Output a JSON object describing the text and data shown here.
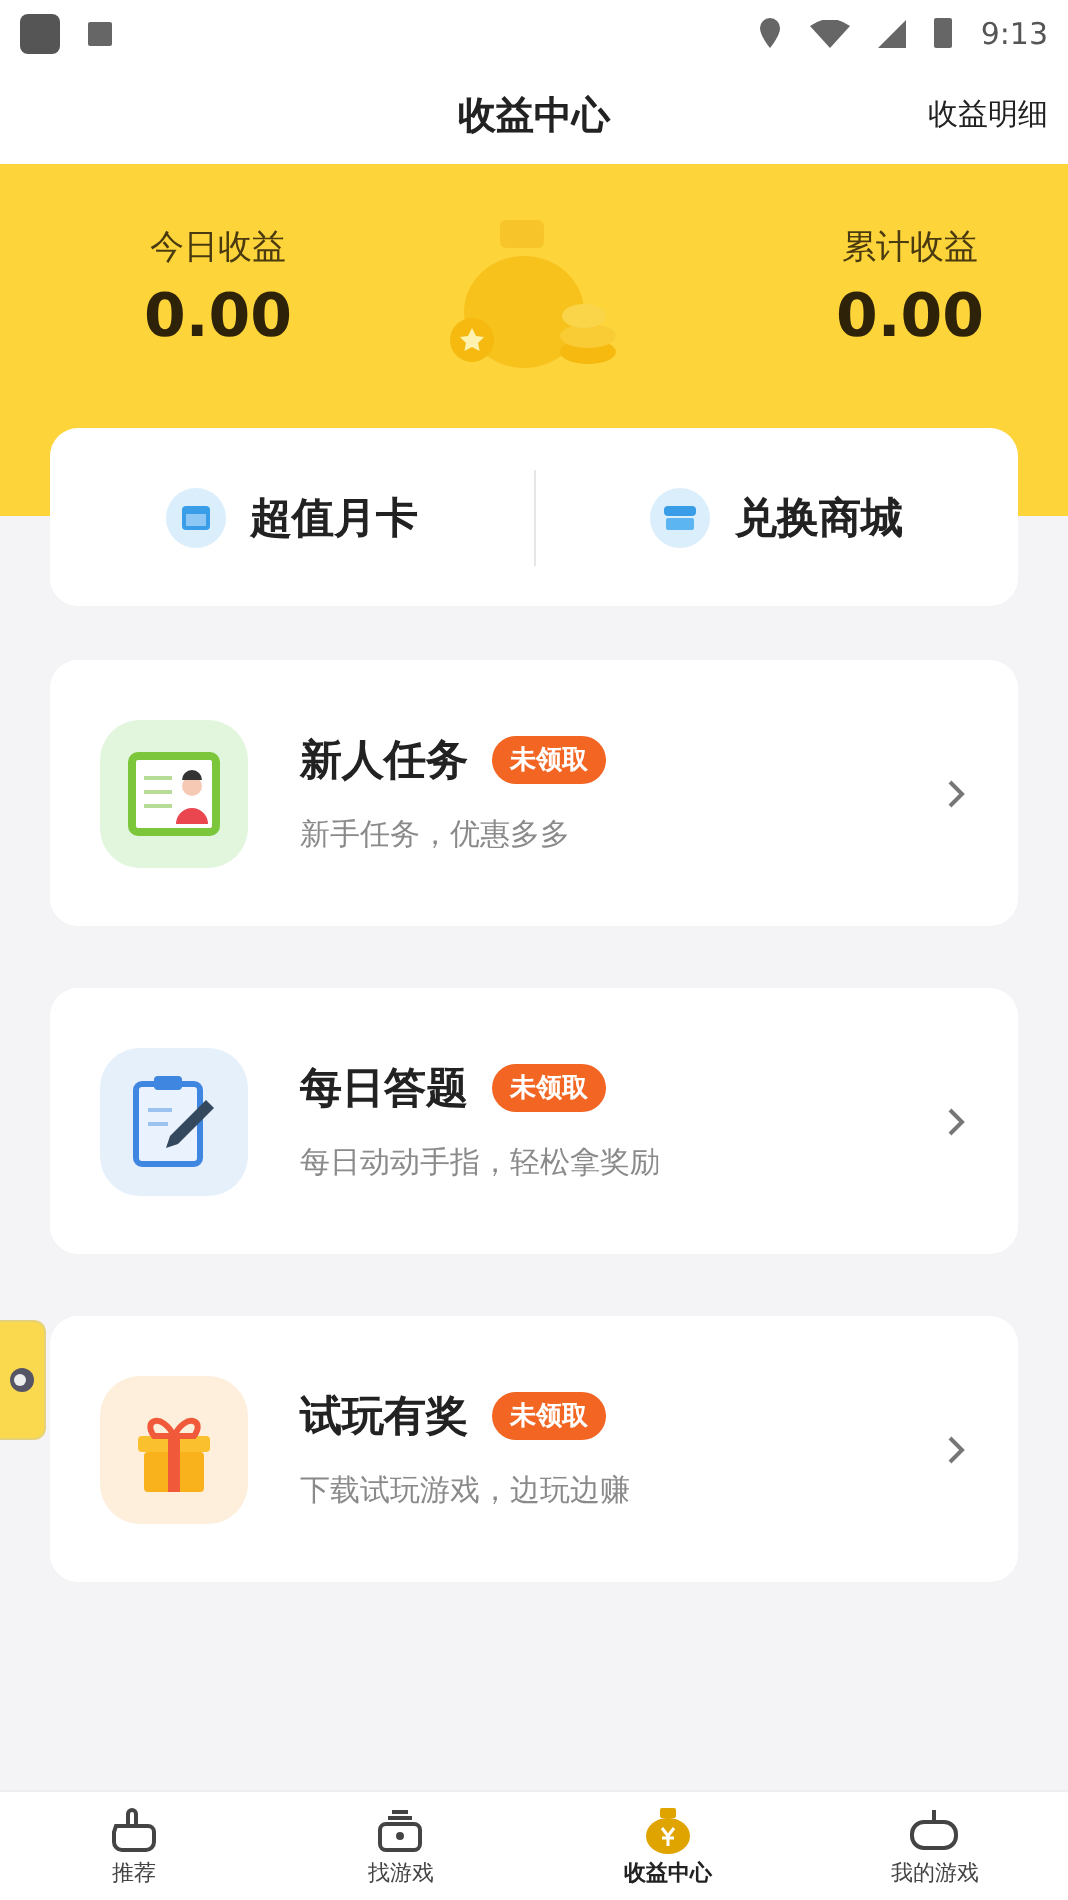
{
  "status_bar": {
    "time": "9:13"
  },
  "header": {
    "title": "收益中心",
    "action": "收益明细"
  },
  "earnings": [
    {
      "label": "今日收益",
      "value": "0.00"
    },
    {
      "label": "累计收益",
      "value": "0.00"
    }
  ],
  "quick_links": [
    {
      "kind": "card",
      "label": "超值月卡"
    },
    {
      "kind": "shop",
      "label": "兑换商城"
    }
  ],
  "tasks": [
    {
      "kind": "newbie",
      "title": "新人任务",
      "badge": "未领取",
      "subtitle": "新手任务，优惠多多"
    },
    {
      "kind": "quiz",
      "title": "每日答题",
      "badge": "未领取",
      "subtitle": "每日动动手指，轻松拿奖励"
    },
    {
      "kind": "gift",
      "title": "试玩有奖",
      "badge": "未领取",
      "subtitle": "下载试玩游戏，边玩边赚"
    }
  ],
  "tab_bar": [
    {
      "kind": "recommend",
      "label": "推荐",
      "selected": false
    },
    {
      "kind": "find",
      "label": "找游戏",
      "selected": false
    },
    {
      "kind": "earn",
      "label": "收益中心",
      "selected": true
    },
    {
      "kind": "mine",
      "label": "我的游戏",
      "selected": false
    }
  ]
}
